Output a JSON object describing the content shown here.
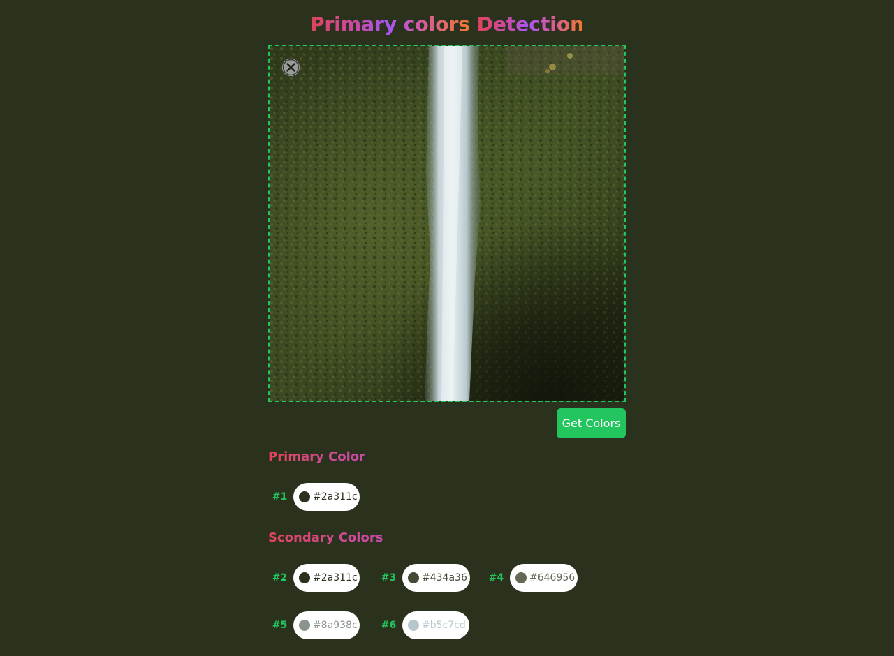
{
  "header": {
    "title_primary": "Primary colors",
    "title_detection": "Detection"
  },
  "dropzone": {
    "close_icon": "close-circle-icon",
    "image_alt": "Waterfall through dense green foliage"
  },
  "actions": {
    "get_colors_label": "Get Colors",
    "accent_color": "#22c55e"
  },
  "primary": {
    "heading": "Primary Color",
    "swatches": [
      {
        "index": "#1",
        "hex": "#2a311c",
        "text_color": "#2a311c"
      }
    ]
  },
  "secondary": {
    "heading": "Scondary Colors",
    "swatches": [
      {
        "index": "#2",
        "hex": "#2a311c",
        "text_color": "#2a311c"
      },
      {
        "index": "#3",
        "hex": "#434a36",
        "text_color": "#434a36"
      },
      {
        "index": "#4",
        "hex": "#646956",
        "text_color": "#646956"
      },
      {
        "index": "#5",
        "hex": "#8a938c",
        "text_color": "#8a938c"
      },
      {
        "index": "#6",
        "hex": "#b5c7cd",
        "text_color": "#b5c7cd"
      }
    ]
  },
  "colors": {
    "background": "#2a311c",
    "index_text": "#22c55e"
  }
}
